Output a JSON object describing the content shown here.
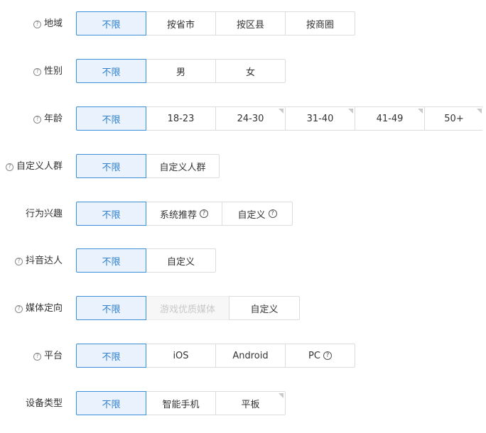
{
  "rows": [
    {
      "label": "地域",
      "options": [
        "不限",
        "按省市",
        "按区县",
        "按商圈"
      ]
    },
    {
      "label": "性别",
      "options": [
        "不限",
        "男",
        "女"
      ]
    },
    {
      "label": "年龄",
      "options": [
        "不限",
        "18-23",
        "24-30",
        "31-40",
        "41-49",
        "50+"
      ]
    },
    {
      "label": "自定义人群",
      "options": [
        "不限",
        "自定义人群"
      ]
    },
    {
      "label": "行为兴趣",
      "options": [
        "不限",
        "系统推荐",
        "自定义"
      ]
    },
    {
      "label": "抖音达人",
      "options": [
        "不限",
        "自定义"
      ]
    },
    {
      "label": "媒体定向",
      "options": [
        "不限",
        "游戏优质媒体",
        "自定义"
      ]
    },
    {
      "label": "平台",
      "options": [
        "不限",
        "iOS",
        "Android",
        "PC"
      ]
    },
    {
      "label": "设备类型",
      "options": [
        "不限",
        "智能手机",
        "平板"
      ]
    }
  ],
  "selected_value": "不限",
  "help_glyph": "?",
  "colors": {
    "accent": "#3b8fd9",
    "selected_bg": "#eaf3fd",
    "border": "#dcdcdc",
    "disabled_text": "#c8c8c8"
  }
}
